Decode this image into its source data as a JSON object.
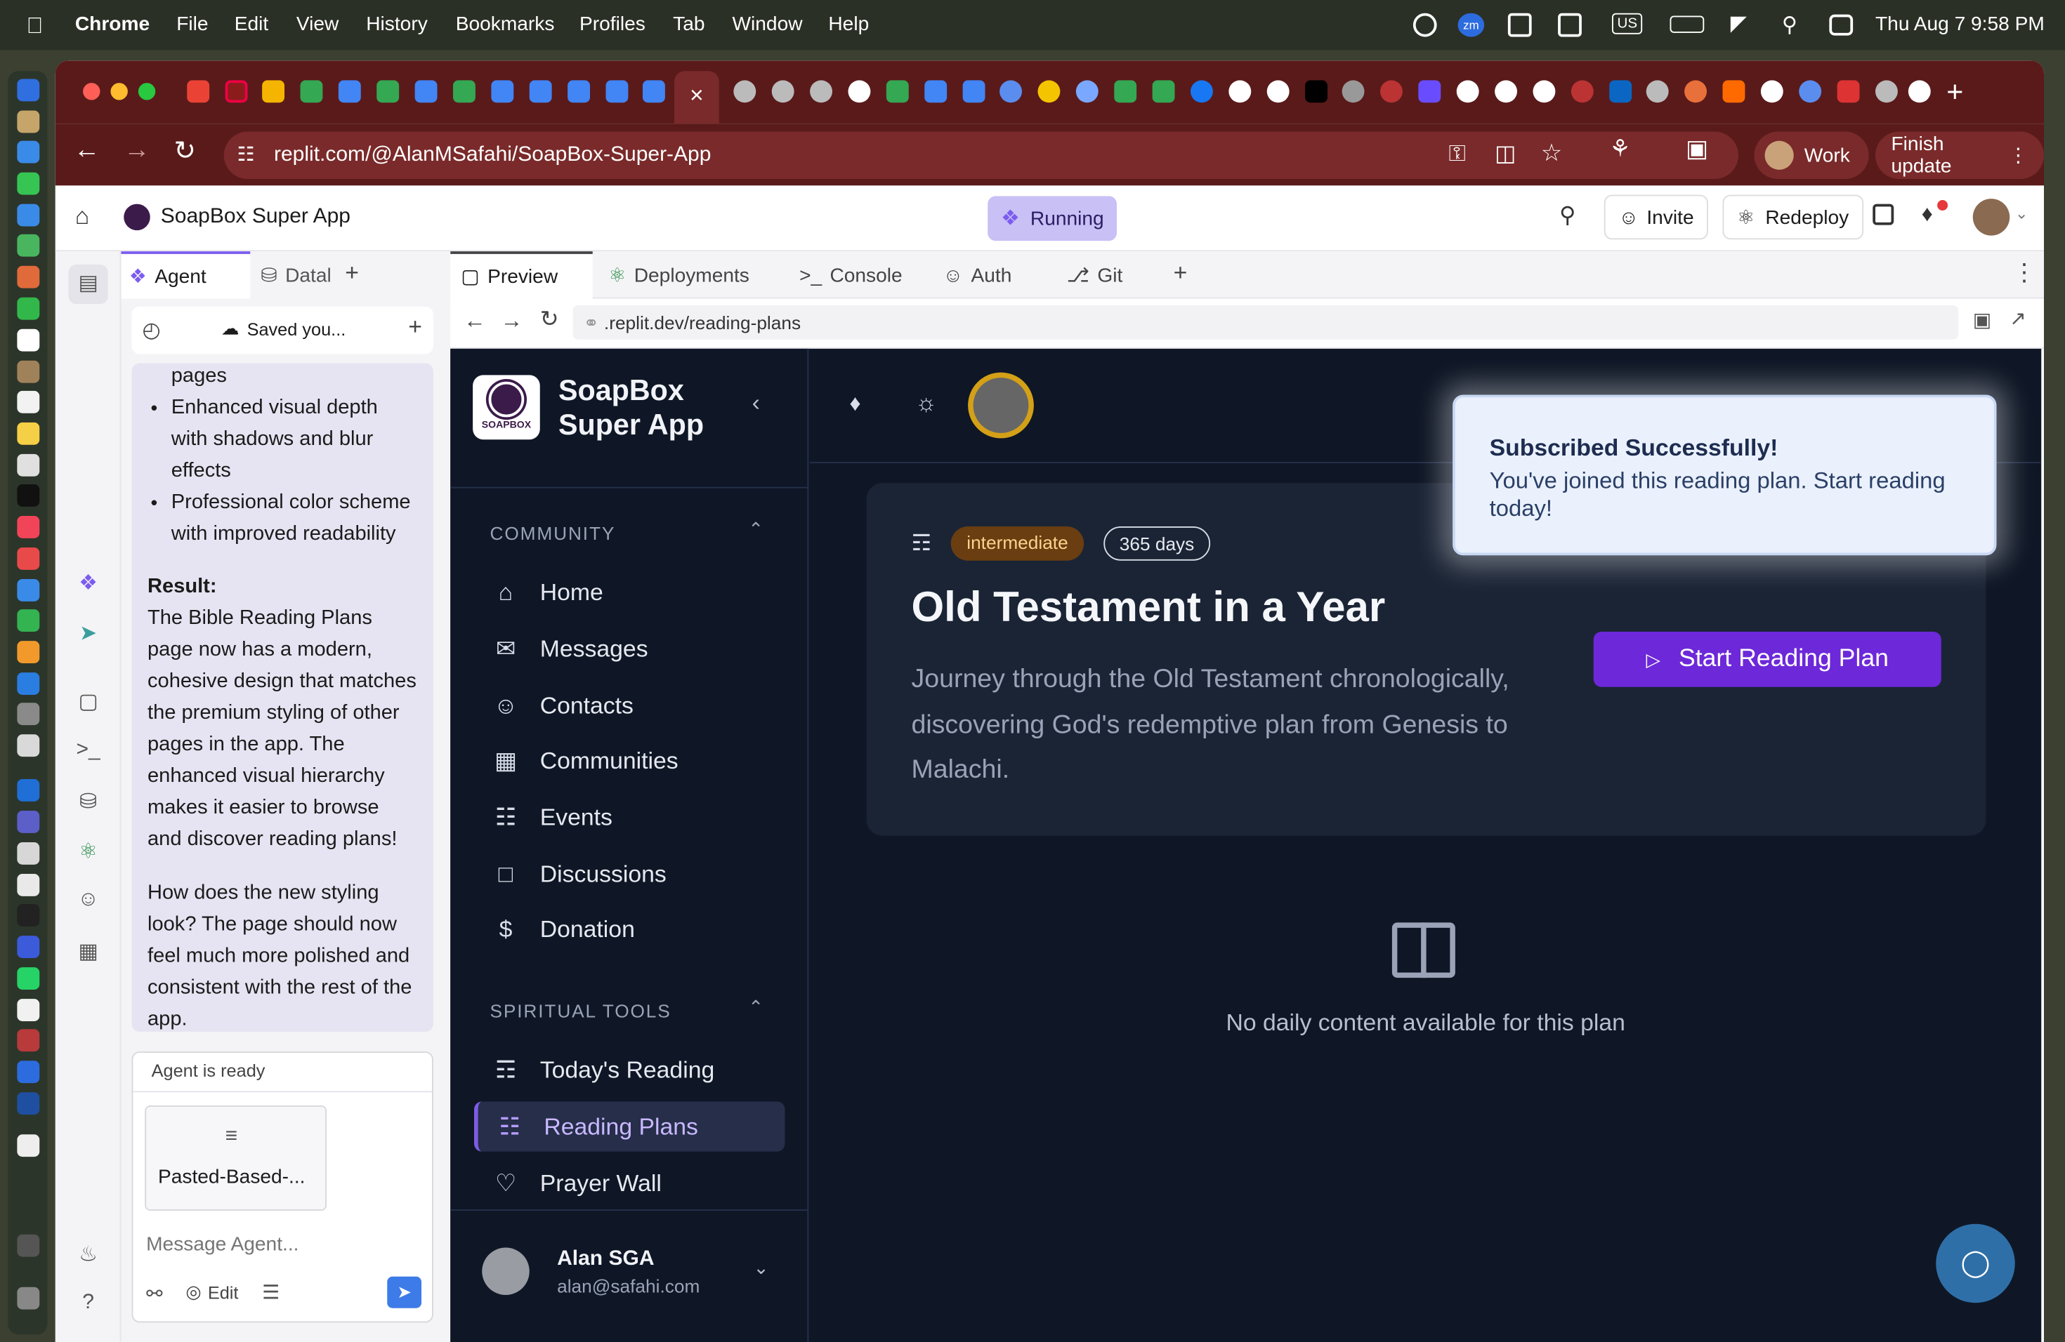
{
  "menubar": {
    "app": "Chrome",
    "items": [
      "File",
      "Edit",
      "View",
      "History",
      "Bookmarks",
      "Profiles",
      "Tab",
      "Window",
      "Help"
    ],
    "status_icons": [
      "zm",
      "US"
    ],
    "clock": "Thu Aug 7  9:58 PM"
  },
  "browser": {
    "url": "replit.com/@AlanMSafahi/SoapBox-Super-App",
    "profile": "Work",
    "finish_update": "Finish update"
  },
  "replit": {
    "project_name": "SoapBox Super App",
    "run_status": "Running",
    "invite": "Invite",
    "redeploy": "Redeploy"
  },
  "agent": {
    "tabs": [
      "Agent",
      "Datal"
    ],
    "toolbar_title": "Saved you...",
    "bullets_partial": "pages",
    "bullets": [
      "Enhanced visual depth with shadows and blur effects",
      "Professional color scheme with improved readability"
    ],
    "result_label": "Result:",
    "result_text": "The Bible Reading Plans page now has a modern, cohesive design that matches the premium styling of other pages in the app. The enhanced visual hierarchy makes it easier to browse and discover reading plans!",
    "question": "How does the new styling look? The page should now feel much more polished and consistent with the rest of the app.",
    "status": "Agent is ready",
    "attachment": "Pasted-Based-...",
    "input_placeholder": "Message Agent...",
    "edit_label": "Edit"
  },
  "workspace": {
    "tabs": [
      "Preview",
      "Deployments",
      "Console",
      "Auth",
      "Git"
    ],
    "preview_url": ".replit.dev/reading-plans"
  },
  "app": {
    "brand_line1": "SoapBox",
    "brand_line2": "Super App",
    "logo_text": "SOAPBOX",
    "community_header": "COMMUNITY",
    "community_items": [
      "Home",
      "Messages",
      "Contacts",
      "Communities",
      "Events",
      "Discussions",
      "Donation"
    ],
    "tools_header": "SPIRITUAL TOOLS",
    "tools_items": [
      "Today's Reading",
      "Reading Plans",
      "Prayer Wall"
    ],
    "user_name": "Alan SGA",
    "user_email": "alan@safahi.com",
    "plan": {
      "level": "intermediate",
      "duration": "365 days",
      "title": "Old Testament in a Year",
      "description": "Journey through the Old Testament chronologically, discovering God's redemptive plan from Genesis to Malachi.",
      "cta": "Start Reading Plan"
    },
    "empty_text": "No daily content available for this plan",
    "toast": {
      "title": "Subscribed Successfully!",
      "body": "You've joined this reading plan. Start reading today!"
    }
  },
  "colors": {
    "accent": "#6d28d9",
    "sidebar_bg": "#0f1726",
    "card_bg": "#1b2435",
    "badge_intermediate": "#7c4a12"
  }
}
